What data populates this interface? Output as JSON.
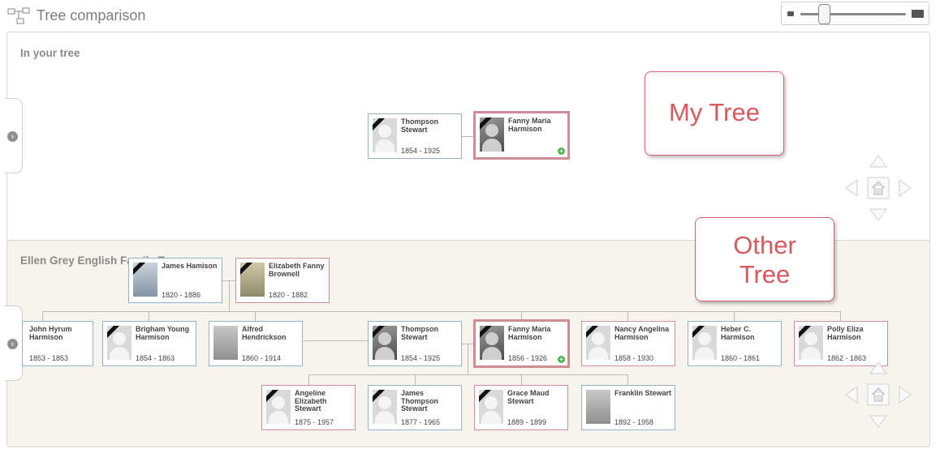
{
  "header": {
    "title": "Tree comparison"
  },
  "icons": {
    "tree": "tree-icon",
    "nav_up": "arrow-up-icon",
    "nav_down": "arrow-down-icon",
    "nav_left": "arrow-left-icon",
    "nav_right": "arrow-right-icon",
    "home": "home-icon",
    "expand": "chevron-right-icon",
    "add": "plus-icon"
  },
  "zoom": {
    "level": 0.23
  },
  "top_pane": {
    "label": "In your tree",
    "note": "My Tree"
  },
  "bottom_pane": {
    "label": "Ellen Grey English Family Tree",
    "note_line1": "Other",
    "note_line2": "Tree"
  },
  "colors": {
    "male_border": "#8fb4cc",
    "female_border": "#d38b95",
    "note_text": "#d65a5d"
  },
  "my_tree": [
    {
      "name": "Thompson Stewart",
      "years": "1854 - 1925"
    },
    {
      "name": "Fanny Maria Harmison",
      "years": ""
    }
  ],
  "other_tree": {
    "parents": [
      {
        "name": "James Hamison",
        "years": "1820 - 1886"
      },
      {
        "name": "Elizabeth Fanny Brownell",
        "years": "1820 - 1882"
      }
    ],
    "siblings": [
      {
        "name": "John Hyrum Harmison",
        "years": "1853 - 1853"
      },
      {
        "name": "Brigham Young Harmison",
        "years": "1854 - 1863"
      },
      {
        "name": "Alfred Hendrickson",
        "years": "1860 - 1914"
      },
      {
        "name": "Thompson Stewart",
        "years": "1854 - 1925"
      },
      {
        "name": "Fanny Maria Harmison",
        "years": "1856 - 1926"
      },
      {
        "name": "Nancy Angelina Harmison",
        "years": "1858 - 1930"
      },
      {
        "name": "Heber C. Harmison",
        "years": "1860 - 1861"
      },
      {
        "name": "Polly Eliza Harmison",
        "years": "1862 - 1863"
      }
    ],
    "children": [
      {
        "name": "Angeline Elizabeth Stewart",
        "years": "1875 - 1957"
      },
      {
        "name": "James Thompson Stewart",
        "years": "1877 - 1965"
      },
      {
        "name": "Grace Maud Stewart",
        "years": "1889 - 1899"
      },
      {
        "name": "Franklin Stewart",
        "years": "1892 - 1958"
      }
    ]
  }
}
